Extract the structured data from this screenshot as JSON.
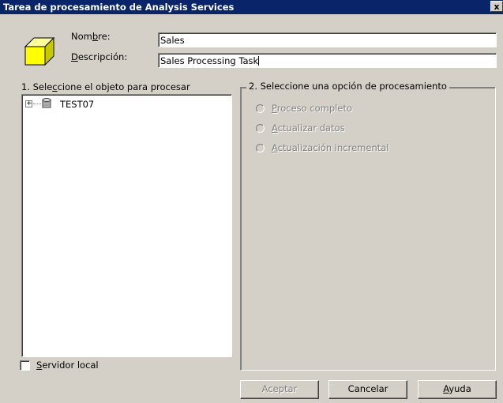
{
  "window": {
    "title": "Tarea de procesamiento de Analysis Services",
    "close_glyph": "x"
  },
  "header": {
    "name_label_pre": "Nom",
    "name_label_key": "b",
    "name_label_post": "re:",
    "name_value": "Sales",
    "desc_label_key": "D",
    "desc_label_post": "escripción:",
    "desc_value": "Sales Processing Task"
  },
  "left_panel": {
    "label_pre": "1. Sele",
    "label_key": "c",
    "label_post": "cione el objeto para procesar",
    "tree": [
      {
        "label": "TEST07",
        "icon": "database-icon",
        "expander": "+"
      }
    ]
  },
  "right_panel": {
    "label": "2. Seleccione una opción de procesamiento",
    "options": [
      {
        "key": "P",
        "rest": "roceso completo"
      },
      {
        "key": "A",
        "rest": "ctualizar datos"
      },
      {
        "key": "A",
        "rest": "ctualización incremental"
      }
    ]
  },
  "local_server": {
    "key": "S",
    "rest": "ervidor local",
    "checked": false
  },
  "buttons": {
    "ok": "Aceptar",
    "cancel": "Cancelar",
    "help_key": "A",
    "help_rest": "yuda"
  },
  "colors": {
    "titlebar": "#0a246a",
    "face": "#d4d0c8",
    "cube": "#ffff00"
  }
}
